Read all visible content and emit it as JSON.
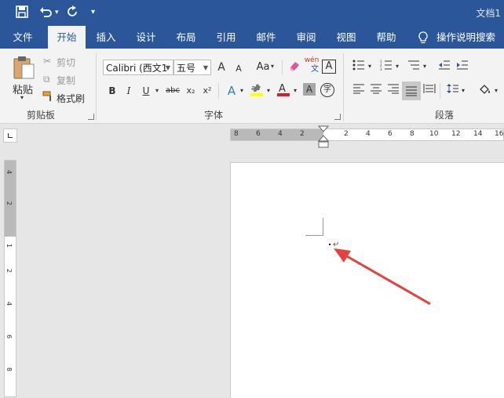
{
  "title_bar": {
    "doc_title": "文档1",
    "qat": {
      "save_icon": "save-icon",
      "undo_icon": "undo-icon",
      "redo_icon": "redo-icon",
      "customize_icon": "customize-qat-icon"
    }
  },
  "menu": {
    "items": [
      "文件",
      "开始",
      "插入",
      "设计",
      "布局",
      "引用",
      "邮件",
      "审阅",
      "视图",
      "帮助",
      "操作说明搜索"
    ],
    "active": "开始"
  },
  "clipboard": {
    "paste": "粘贴",
    "cut": "剪切",
    "copy": "复制",
    "format_painter": "格式刷",
    "group_label": "剪贴板"
  },
  "font": {
    "font_name": "Calibri (西文1",
    "font_size": "五号",
    "group_label": "字体",
    "buttons": {
      "grow": "A",
      "shrink": "A",
      "case": "Aa",
      "bold": "B",
      "italic": "I",
      "underline": "U",
      "strike": "abc",
      "sub": "x₂",
      "sup": "x²",
      "phonetic": "wén",
      "border_char": "A",
      "circle_char": "字"
    }
  },
  "paragraph": {
    "group_label": "段落"
  },
  "ruler": {
    "h_numbers": [
      "8",
      "6",
      "4",
      "2",
      "2",
      "4",
      "6",
      "8",
      "10",
      "12",
      "14",
      "16"
    ],
    "v_numbers": [
      "4",
      "2",
      "1",
      "2",
      "4",
      "6",
      "8"
    ]
  },
  "colors": {
    "ribbon_blue": "#2b579a",
    "arrow_red": "#e5413d"
  },
  "document": {
    "paragraph_mark": "↵"
  }
}
